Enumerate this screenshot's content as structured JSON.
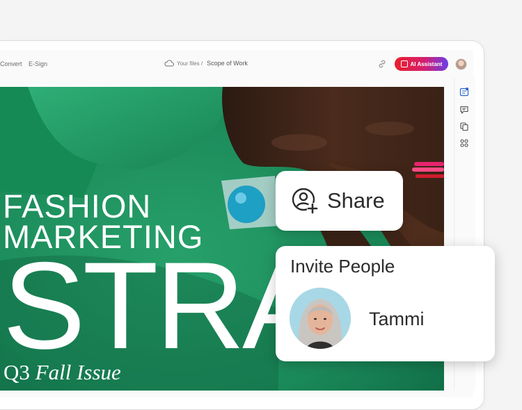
{
  "toolbar": {
    "convert_label": "Convert",
    "esign_label": "E-Sign",
    "breadcrumb_root": "Your files /",
    "breadcrumb_doc": "Scope of Work",
    "ai_assistant_label": "AI Assistant"
  },
  "document": {
    "title_line1": "FASHION",
    "title_line2": "MARKETING",
    "title_big": "STRA",
    "issue_prefix": "Q3",
    "issue_suffix": "Fall Issue"
  },
  "share_card": {
    "label": "Share",
    "icon": "add-person-icon"
  },
  "invite_card": {
    "heading": "Invite People",
    "person_name": "Tammi"
  },
  "sidebar": {
    "icons": [
      "edit-text-icon",
      "comment-icon",
      "copy-pages-icon",
      "grid-apps-icon"
    ]
  },
  "colors": {
    "ai_gradient_start": "#e8202a",
    "ai_gradient_end": "#6a3de8",
    "canvas_green": "#1a8a5c"
  }
}
